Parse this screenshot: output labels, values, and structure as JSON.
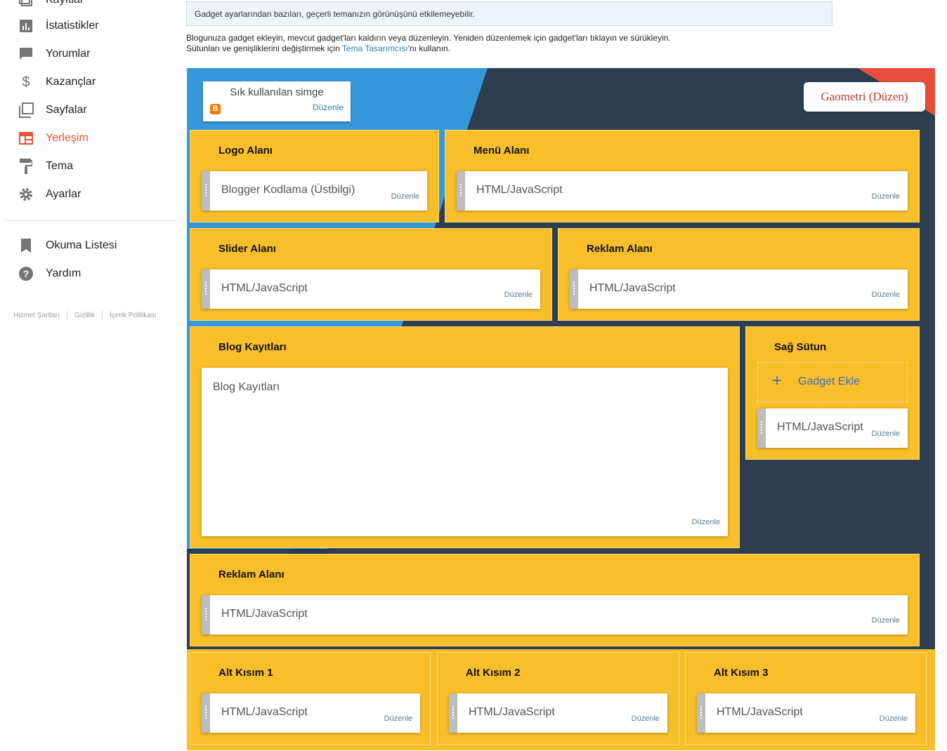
{
  "sidebar": {
    "items": [
      {
        "label": "Kayıtlar",
        "icon": "posts-icon"
      },
      {
        "label": "İstatistikler",
        "icon": "stats-icon"
      },
      {
        "label": "Yorumlar",
        "icon": "comments-icon"
      },
      {
        "label": "Kazançlar",
        "icon": "dollar-icon"
      },
      {
        "label": "Sayfalar",
        "icon": "pages-icon"
      },
      {
        "label": "Yerleşim",
        "icon": "layout-icon",
        "active": true
      },
      {
        "label": "Tema",
        "icon": "paint-roller-icon"
      },
      {
        "label": "Ayarlar",
        "icon": "gear-icon"
      },
      {
        "label": "Okuma Listesi",
        "icon": "bookmark-icon"
      },
      {
        "label": "Yardım",
        "icon": "help-icon"
      }
    ],
    "footer": [
      "Hizmet Şartları",
      "Gizlilik",
      "İçerik Politikası"
    ]
  },
  "notice": "Gadget ayarlarından bazıları, geçerli temanızın görünüşünü etkilemeyebilir.",
  "intro": {
    "line1": "Blogunuza gadget ekleyin, mevcut gadget'ları kaldırın veya düzenleyin. Yeniden düzenlemek için gadget'ları tıklayın ve sürükleyin.",
    "line2_before": "Sütunları ve genişliklerini değiştirmek için ",
    "line2_link": "Tema Tasarımcısı",
    "line2_after": "'nı kullanın."
  },
  "layout": {
    "favicon": {
      "title": "Sık kullanılan simge",
      "edit": "Düzenle"
    },
    "blog_title_button": "Gaometri (Düzen)",
    "edit_label": "Düzenle",
    "add_gadget": "Gadget Ekle",
    "sections": {
      "logo": {
        "title": "Logo Alanı",
        "widget": "Blogger Kodlama (Üstbilgi)"
      },
      "menu": {
        "title": "Menü Alanı",
        "widget": "HTML/JavaScript"
      },
      "slider": {
        "title": "Slider Alanı",
        "widget": "HTML/JavaScript"
      },
      "ad_top": {
        "title": "Reklam Alanı",
        "widget": "HTML/JavaScript"
      },
      "blog": {
        "title": "Blog Kayıtları",
        "widget": "Blog Kayıtları"
      },
      "right": {
        "title": "Sağ Sütun",
        "widget": "HTML/JavaScript"
      },
      "ad_bottom": {
        "title": "Reklam Alanı",
        "widget": "HTML/JavaScript"
      },
      "footer1": {
        "title": "Alt Kısım 1",
        "widget": "HTML/JavaScript"
      },
      "footer2": {
        "title": "Alt Kısım 2",
        "widget": "HTML/JavaScript"
      },
      "footer3": {
        "title": "Alt Kısım 3",
        "widget": "HTML/JavaScript"
      }
    }
  },
  "colors": {
    "accent": "#e65432",
    "section": "#f9bf2a",
    "link": "#2f7fa8",
    "bg_blue": "#3498db",
    "bg_dark": "#2c3e50",
    "bg_red": "#e74c3c"
  }
}
